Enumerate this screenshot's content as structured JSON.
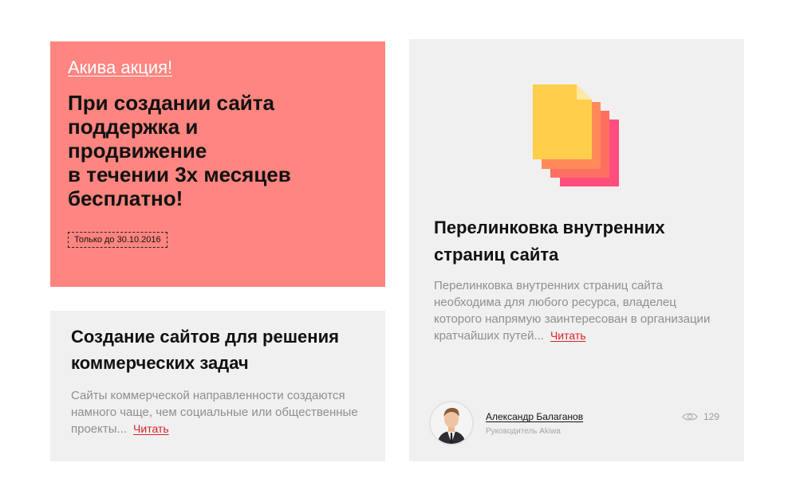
{
  "promo": {
    "link": "Акива акция!",
    "title_lines": [
      "При создании сайта",
      "поддержка и",
      "продвижение",
      "в течении 3х месяцев",
      "бесплатно!"
    ],
    "badge": "Только до 30.10.2016"
  },
  "card_a": {
    "title_lines": [
      "Создание сайтов для решения",
      "коммерческих задач"
    ],
    "desc": "Сайты коммерческой направленности создаются намного чаще, чем социальные или общественные проекты...",
    "read": "Читать"
  },
  "card_b": {
    "icon": "documents-stack-icon",
    "title_lines": [
      "Перелинковка внутренних",
      "страниц сайта"
    ],
    "desc": "Перелинковка внутренних страниц сайта необходима для любого ресурса, владелец которого напрямую заинтересован в организации кратчайших путей...",
    "read": "Читать",
    "author": {
      "name": "Александр Балаганов",
      "role": "Руководитель Akiwa"
    },
    "views": "129"
  },
  "colors": {
    "promo_bg": "#ff8580",
    "card_bg": "#f0f0f0",
    "link_red": "#d4212b",
    "doc_yellow": "#ffce4a",
    "doc_orange": "#ff8a5a",
    "doc_pink": "#ff4d7d"
  }
}
